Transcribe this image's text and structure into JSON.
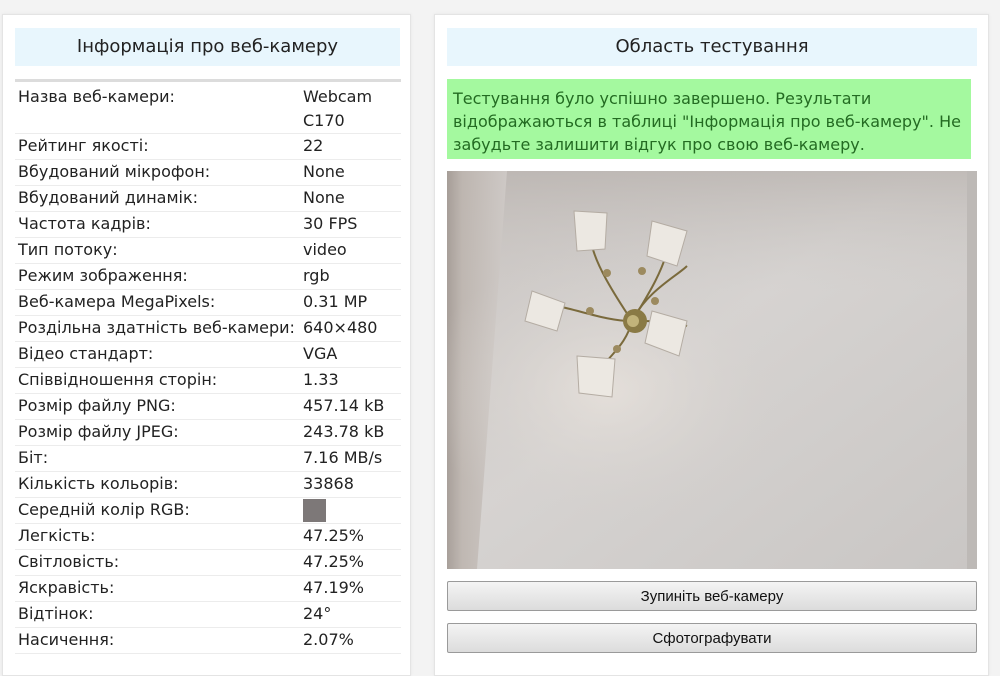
{
  "left": {
    "title": "Інформація про веб-камеру",
    "rows": [
      {
        "label": "Назва веб-камери:",
        "value": "Webcam C170"
      },
      {
        "label": "Рейтинг якості:",
        "value": "22"
      },
      {
        "label": "Вбудований мікрофон:",
        "value": "None"
      },
      {
        "label": "Вбудований динамік:",
        "value": "None"
      },
      {
        "label": "Частота кадрів:",
        "value": "30 FPS"
      },
      {
        "label": "Тип потоку:",
        "value": "video"
      },
      {
        "label": "Режим зображення:",
        "value": "rgb"
      },
      {
        "label": "Веб-камера MegaPixels:",
        "value": "0.31 MP"
      },
      {
        "label": "Роздільна здатність веб-камери:",
        "value": "640×480"
      },
      {
        "label": "Відео стандарт:",
        "value": "VGA"
      },
      {
        "label": "Співвідношення сторін:",
        "value": "1.33"
      },
      {
        "label": "Розмір файлу PNG:",
        "value": "457.14 kB"
      },
      {
        "label": "Розмір файлу JPEG:",
        "value": "243.78 kB"
      },
      {
        "label": "Біт:",
        "value": "7.16 MB/s"
      },
      {
        "label": "Кількість кольорів:",
        "value": "33868"
      },
      {
        "label": "Середній колір RGB:",
        "value": "",
        "swatch_color": "#7d7878"
      },
      {
        "label": "Легкість:",
        "value": "47.25%"
      },
      {
        "label": "Світловість:",
        "value": "47.25%"
      },
      {
        "label": "Яскравість:",
        "value": "47.19%"
      },
      {
        "label": "Відтінок:",
        "value": "24°"
      },
      {
        "label": "Насичення:",
        "value": "2.07%"
      }
    ]
  },
  "right": {
    "title": "Область тестування",
    "success_message": "Тестування було успішно завершено. Результати відображаються в таблиці \"Інформація про веб-камеру\". Не забудьте залишити відгук про свою веб-камеру.",
    "stop_button": "Зупиніть веб-камеру",
    "photo_button": "Сфотографувати"
  },
  "colors": {
    "header_bg": "#e8f6fd",
    "success_bg": "#a4f99f",
    "success_text": "#236b22"
  }
}
